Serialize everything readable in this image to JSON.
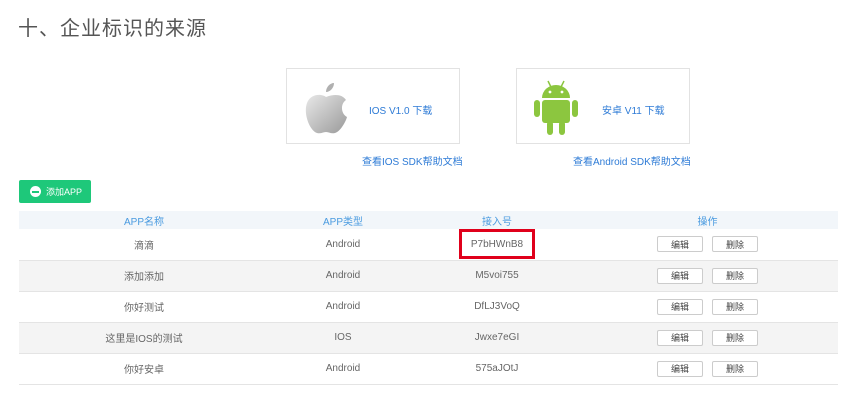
{
  "section_title": "十、企业标识的来源",
  "sdk": {
    "ios": {
      "download_label": "IOS V1.0 下载",
      "doc_label": "查看IOS SDK帮助文档",
      "icon": "apple-logo-icon"
    },
    "android": {
      "download_label": "安卓 V11 下载",
      "doc_label": "查看Android SDK帮助文档",
      "icon": "android-robot-icon"
    }
  },
  "add_button": {
    "label": "添加APP",
    "icon": "minus-circle-icon"
  },
  "table": {
    "headers": [
      "APP名称",
      "APP类型",
      "接入号",
      "操作"
    ],
    "rows": [
      {
        "name": "滴滴",
        "type": "Android",
        "key": "P7bHWnB8",
        "edit": "编辑",
        "delete": "删除"
      },
      {
        "name": "添加添加",
        "type": "Android",
        "key": "M5voi755",
        "edit": "编辑",
        "delete": "删除"
      },
      {
        "name": "你好测试",
        "type": "Android",
        "key": "DfLJ3VoQ",
        "edit": "编辑",
        "delete": "删除"
      },
      {
        "name": "这里是IOS的测试",
        "type": "IOS",
        "key": "Jwxe7eGI",
        "edit": "编辑",
        "delete": "删除"
      },
      {
        "name": "你好安卓",
        "type": "Android",
        "key": "575aJOtJ",
        "edit": "编辑",
        "delete": "删除"
      }
    ]
  },
  "colors": {
    "accent_green": "#1ec87a",
    "link_blue": "#2e7bd6",
    "header_blue": "#4a9be0",
    "highlight_red": "#e0001b",
    "android_green": "#8cc63f"
  }
}
